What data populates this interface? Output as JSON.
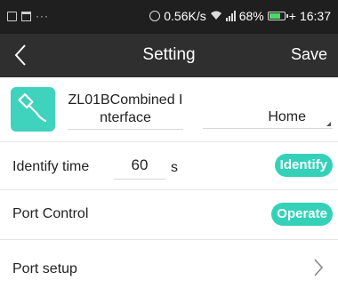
{
  "status_bar": {
    "left_dots": "···",
    "network_speed": "0.56K/s",
    "battery_percent": "68%",
    "battery_level": 0.68,
    "charging_symbol": "+",
    "time": "16:37"
  },
  "nav": {
    "back_icon": "chevron-left-icon",
    "title": "Setting",
    "save_label": "Save"
  },
  "device": {
    "icon": "usb-plug-icon",
    "name": "ZL01BCombined Interface",
    "room": "Home"
  },
  "identify": {
    "label": "Identify time",
    "value": "60",
    "unit": "s",
    "button_label": "Identify"
  },
  "port_control": {
    "label": "Port Control",
    "button_label": "Operate"
  },
  "port_setup": {
    "label": "Port setup",
    "chevron_icon": "chevron-right-icon"
  },
  "colors": {
    "accent": "#34d1b9",
    "status_bar": "#1f1f1f",
    "nav_bar": "#2f2f2f"
  }
}
